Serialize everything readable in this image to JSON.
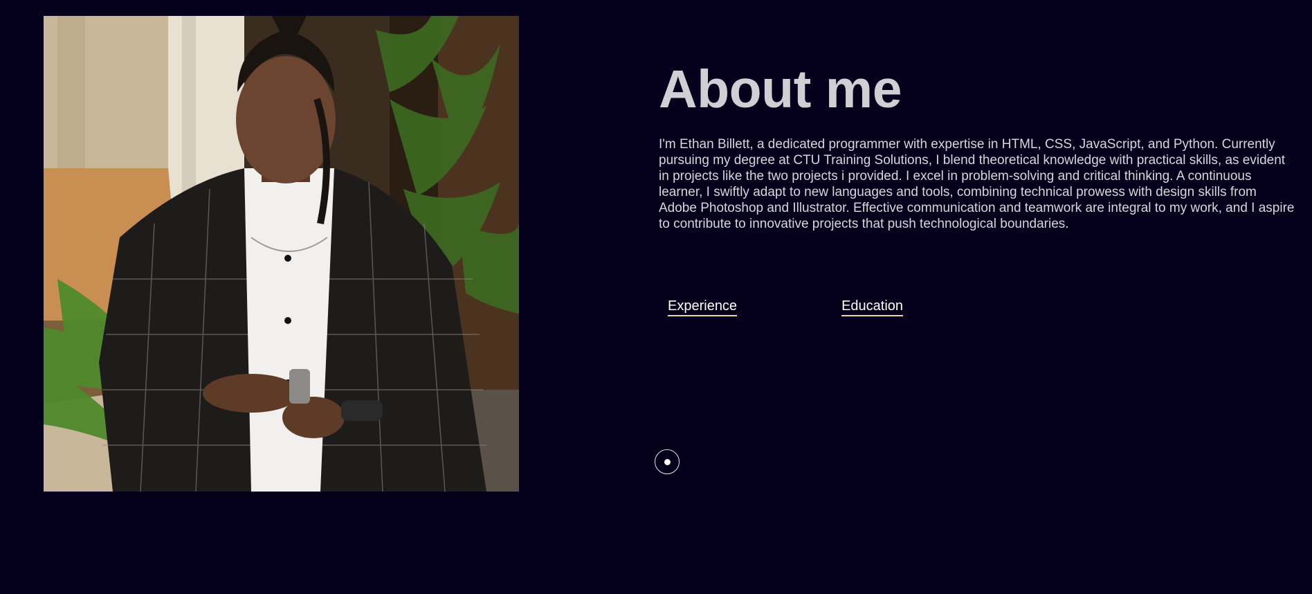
{
  "about": {
    "title": "About me",
    "bio": "I'm Ethan Billett, a dedicated programmer with expertise in HTML, CSS, JavaScript, and Python. Currently pursuing my degree at CTU Training Solutions, I blend theoretical knowledge with practical skills, as evident in projects like the two projects i provided. I excel in problem-solving and critical thinking. A continuous learner, I swiftly adapt to new languages and tools, combining technical prowess with design skills from Adobe Photoshop and Illustrator. Effective communication and teamwork are integral to my work, and I aspire to contribute to innovative projects that push technological boundaries."
  },
  "tabs": [
    {
      "label": "Experience"
    },
    {
      "label": "Education"
    }
  ],
  "colors": {
    "background": "#05001b",
    "title": "#cfcfd4",
    "text": "#d6d6dc",
    "tab_underline": "#f0d9a0"
  }
}
